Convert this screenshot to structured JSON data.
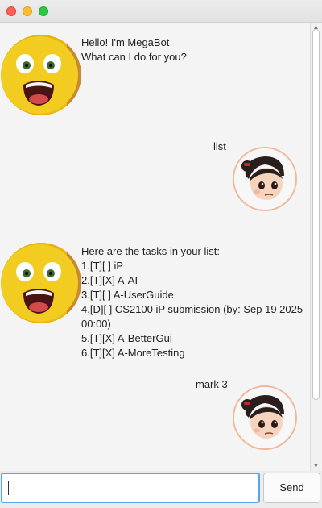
{
  "window": {
    "title": ""
  },
  "conversation": [
    {
      "speaker": "bot",
      "avatar": "yellow-character-avatar",
      "text": "Hello! I'm MegaBot\nWhat can I do for you?"
    },
    {
      "speaker": "user",
      "avatar": "girl-character-avatar",
      "text": "list"
    },
    {
      "speaker": "bot",
      "avatar": "yellow-character-avatar",
      "text": "Here are the tasks in your list:\n1.[T][ ] iP\n2.[T][X] A-AI\n3.[T][ ] A-UserGuide\n4.[D][ ] CS2100 iP submission (by: Sep 19 2025\n00:00)\n5.[T][X] A-BetterGui\n6.[T][X] A-MoreTesting"
    },
    {
      "speaker": "user",
      "avatar": "girl-character-avatar",
      "text": "mark 3"
    }
  ],
  "input": {
    "value": "",
    "placeholder": ""
  },
  "send_label": "Send",
  "colors": {
    "input_focus": "#5aa4ee",
    "dialog_bg": "#f4f4f4",
    "user_avatar_border": "#f0b89a"
  }
}
